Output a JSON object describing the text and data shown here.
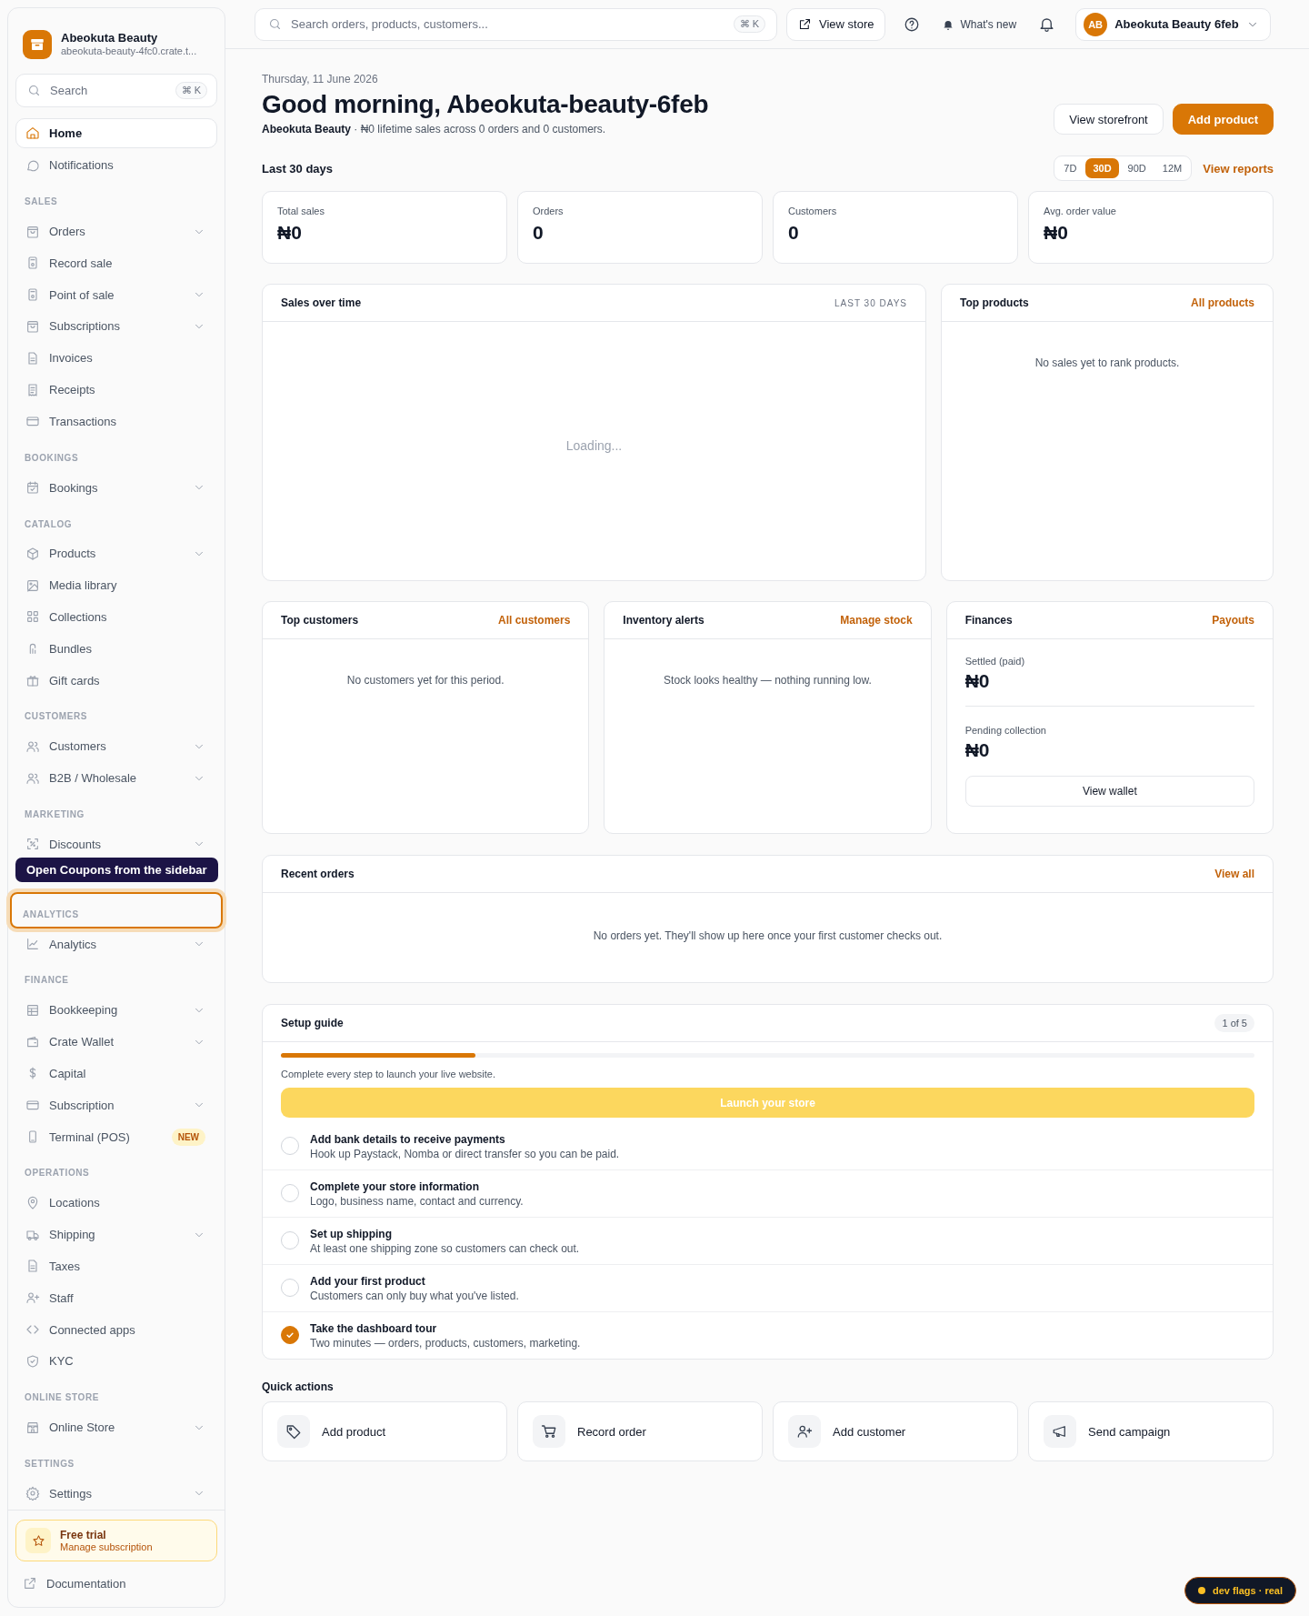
{
  "brand": {
    "name": "Abeokuta Beauty",
    "url": "abeokuta-beauty-4fc0.crate.t..."
  },
  "sidebar": {
    "search": {
      "placeholder": "Search",
      "shortcut": "⌘ K"
    },
    "top_items": [
      {
        "label": "Home",
        "selected": true,
        "expandable": false
      },
      {
        "label": "Notifications",
        "selected": false,
        "expandable": false
      }
    ],
    "sections": [
      {
        "title": "SALES",
        "highlighted": false,
        "items": [
          {
            "label": "Orders",
            "selected": false,
            "expandable": true
          },
          {
            "label": "Record sale",
            "selected": false,
            "expandable": false
          },
          {
            "label": "Point of sale",
            "selected": false,
            "expandable": true
          },
          {
            "label": "Subscriptions",
            "selected": false,
            "expandable": true
          },
          {
            "label": "Invoices",
            "selected": false,
            "expandable": false
          },
          {
            "label": "Receipts",
            "selected": false,
            "expandable": false
          },
          {
            "label": "Transactions",
            "selected": false,
            "expandable": false
          }
        ]
      },
      {
        "title": "BOOKINGS",
        "highlighted": false,
        "items": [
          {
            "label": "Bookings",
            "selected": false,
            "expandable": true
          }
        ]
      },
      {
        "title": "CATALOG",
        "highlighted": false,
        "items": [
          {
            "label": "Products",
            "selected": false,
            "expandable": true
          },
          {
            "label": "Media library",
            "selected": false,
            "expandable": false
          },
          {
            "label": "Collections",
            "selected": false,
            "expandable": false
          },
          {
            "label": "Bundles",
            "selected": false,
            "expandable": false
          },
          {
            "label": "Gift cards",
            "selected": false,
            "expandable": false
          }
        ]
      },
      {
        "title": "CUSTOMERS",
        "highlighted": false,
        "items": [
          {
            "label": "Customers",
            "selected": false,
            "expandable": true
          },
          {
            "label": "B2B / Wholesale",
            "selected": false,
            "expandable": true
          }
        ]
      },
      {
        "title": "MARKETING",
        "highlighted": false,
        "items": [
          {
            "label": "Discounts",
            "selected": false,
            "expandable": true
          }
        ],
        "tooltip": "Open Coupons from the sidebar"
      },
      {
        "title": "ANALYTICS",
        "highlighted": true,
        "items": [
          {
            "label": "Analytics",
            "selected": false,
            "expandable": true
          }
        ]
      },
      {
        "title": "FINANCE",
        "highlighted": false,
        "items": [
          {
            "label": "Bookkeeping",
            "selected": false,
            "expandable": true
          },
          {
            "label": "Crate Wallet",
            "selected": false,
            "expandable": true
          },
          {
            "label": "Capital",
            "selected": false,
            "expandable": false
          },
          {
            "label": "Subscription",
            "selected": false,
            "expandable": true
          },
          {
            "label": "Terminal (POS)",
            "selected": false,
            "expandable": false,
            "badge": "NEW"
          }
        ]
      },
      {
        "title": "OPERATIONS",
        "highlighted": false,
        "items": [
          {
            "label": "Locations",
            "selected": false,
            "expandable": false
          },
          {
            "label": "Shipping",
            "selected": false,
            "expandable": true
          },
          {
            "label": "Taxes",
            "selected": false,
            "expandable": false
          },
          {
            "label": "Staff",
            "selected": false,
            "expandable": false
          },
          {
            "label": "Connected apps",
            "selected": false,
            "expandable": false
          },
          {
            "label": "KYC",
            "selected": false,
            "expandable": false
          }
        ]
      },
      {
        "title": "ONLINE STORE",
        "highlighted": false,
        "items": [
          {
            "label": "Online Store",
            "selected": false,
            "expandable": true
          }
        ]
      },
      {
        "title": "SETTINGS",
        "highlighted": false,
        "items": [
          {
            "label": "Settings",
            "selected": false,
            "expandable": true
          }
        ]
      }
    ],
    "trial": {
      "title": "Free trial",
      "subtitle": "Manage subscription"
    },
    "documentation": "Documentation"
  },
  "topbar": {
    "search_placeholder": "Search orders, products, customers...",
    "shortcut": "⌘ K",
    "view_store": "View store",
    "whats_new": "What's new",
    "user": {
      "initials": "AB",
      "name": "Abeokuta Beauty 6feb"
    }
  },
  "header": {
    "date": "Thursday, 11 June 2026",
    "greeting": "Good morning, Abeokuta-beauty-6feb",
    "summary": "**Abeokuta Beauty** · ₦0 lifetime sales across 0 orders and 0 customers.",
    "buttons": [
      {
        "label": "View storefront",
        "kind": "secondary"
      },
      {
        "label": "Add product",
        "kind": "primary"
      }
    ]
  },
  "period": {
    "label": "Last 30 days",
    "ranges": [
      {
        "label": "7D",
        "selected": false
      },
      {
        "label": "30D",
        "selected": true
      },
      {
        "label": "90D",
        "selected": false
      },
      {
        "label": "12M",
        "selected": false
      }
    ],
    "link": "View reports"
  },
  "kpis": [
    {
      "label": "Total sales",
      "value": "₦0"
    },
    {
      "label": "Orders",
      "value": "0"
    },
    {
      "label": "Customers",
      "value": "0"
    },
    {
      "label": "Avg. order value",
      "value": "₦0"
    }
  ],
  "sales_over_time": {
    "title": "Sales over time",
    "range": "LAST 30 DAYS",
    "status": "Loading..."
  },
  "top_products": {
    "title": "Top products",
    "link": "All products",
    "empty": "No sales yet to rank products."
  },
  "top_customers": {
    "title": "Top customers",
    "link": "All customers",
    "empty": "No customers yet for this period."
  },
  "inventory_alerts": {
    "title": "Inventory alerts",
    "link": "Manage stock",
    "empty": "Stock looks healthy — nothing running low."
  },
  "finances": {
    "title": "Finances",
    "link": "Payouts",
    "rows": [
      {
        "label": "Settled (paid)",
        "value": "₦0"
      },
      {
        "label": "Pending collection",
        "value": "₦0"
      }
    ],
    "button": "View wallet"
  },
  "recent_orders": {
    "title": "Recent orders",
    "link": "View all",
    "empty": "No orders yet. They'll show up here once your first customer checks out."
  },
  "setup_guide": {
    "title": "Setup guide",
    "count": "1 of 5",
    "level": 0.2,
    "note": "Complete every step to launch your live website.",
    "button": {
      "label": "Launch your store",
      "disabled": true
    },
    "steps": [
      {
        "title": "Add bank details to receive payments",
        "description": "Hook up Paystack, Nomba or direct transfer so you can be paid.",
        "checked": false
      },
      {
        "title": "Complete your store information",
        "description": "Logo, business name, contact and currency.",
        "checked": false
      },
      {
        "title": "Set up shipping",
        "description": "At least one shipping zone so customers can check out.",
        "checked": false
      },
      {
        "title": "Add your first product",
        "description": "Customers can only buy what you've listed.",
        "checked": false
      },
      {
        "title": "Take the dashboard tour",
        "description": "Two minutes — orders, products, customers, marketing.",
        "checked": true
      }
    ]
  },
  "quick_actions": {
    "title": "Quick actions",
    "items": [
      {
        "label": "Add product"
      },
      {
        "label": "Record order"
      },
      {
        "label": "Add customer"
      },
      {
        "label": "Send campaign"
      }
    ]
  },
  "dev_badge": {
    "label": "dev flags · real"
  }
}
